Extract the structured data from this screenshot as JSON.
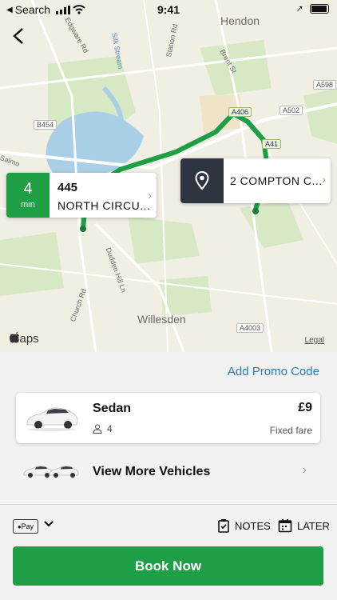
{
  "status_bar": {
    "back_app": "Search",
    "time": "9:41"
  },
  "map": {
    "labels": {
      "hendon": "Hendon",
      "willesden": "Willesden",
      "silk_stream": "Silk Stream",
      "station_rd": "Station Rd",
      "brent_st": "Brent St",
      "edgware_rd": "Edgware Rd",
      "dudden_hill": "Dudden Hill Ln",
      "church_rd": "Church Rd",
      "salmon": "Salmo"
    },
    "road_tags": {
      "a598": "A598",
      "a502": "A502",
      "b454": "B454",
      "a406": "A406",
      "a41": "A41",
      "a4003": "A4003"
    },
    "maps_logo": "Maps",
    "legal": "Legal"
  },
  "pickup_card": {
    "eta_number": "4",
    "eta_unit": "min",
    "line1": "445",
    "line2": "NORTH CIRCU..."
  },
  "destination_card": {
    "label": "2 COMPTON C..."
  },
  "panel": {
    "promo_label": "Add Promo Code",
    "vehicle": {
      "name": "Sedan",
      "seats": "4",
      "price": "£9",
      "fare_type": "Fixed fare"
    },
    "more_vehicles_label": "View More Vehicles",
    "payment_label": "Pay",
    "notes_label": "NOTES",
    "later_label": "LATER",
    "book_label": "Book Now"
  },
  "colors": {
    "brand_green": "#1e9e45",
    "link_blue": "#2a7ec0",
    "dest_dark": "#2f3441"
  }
}
